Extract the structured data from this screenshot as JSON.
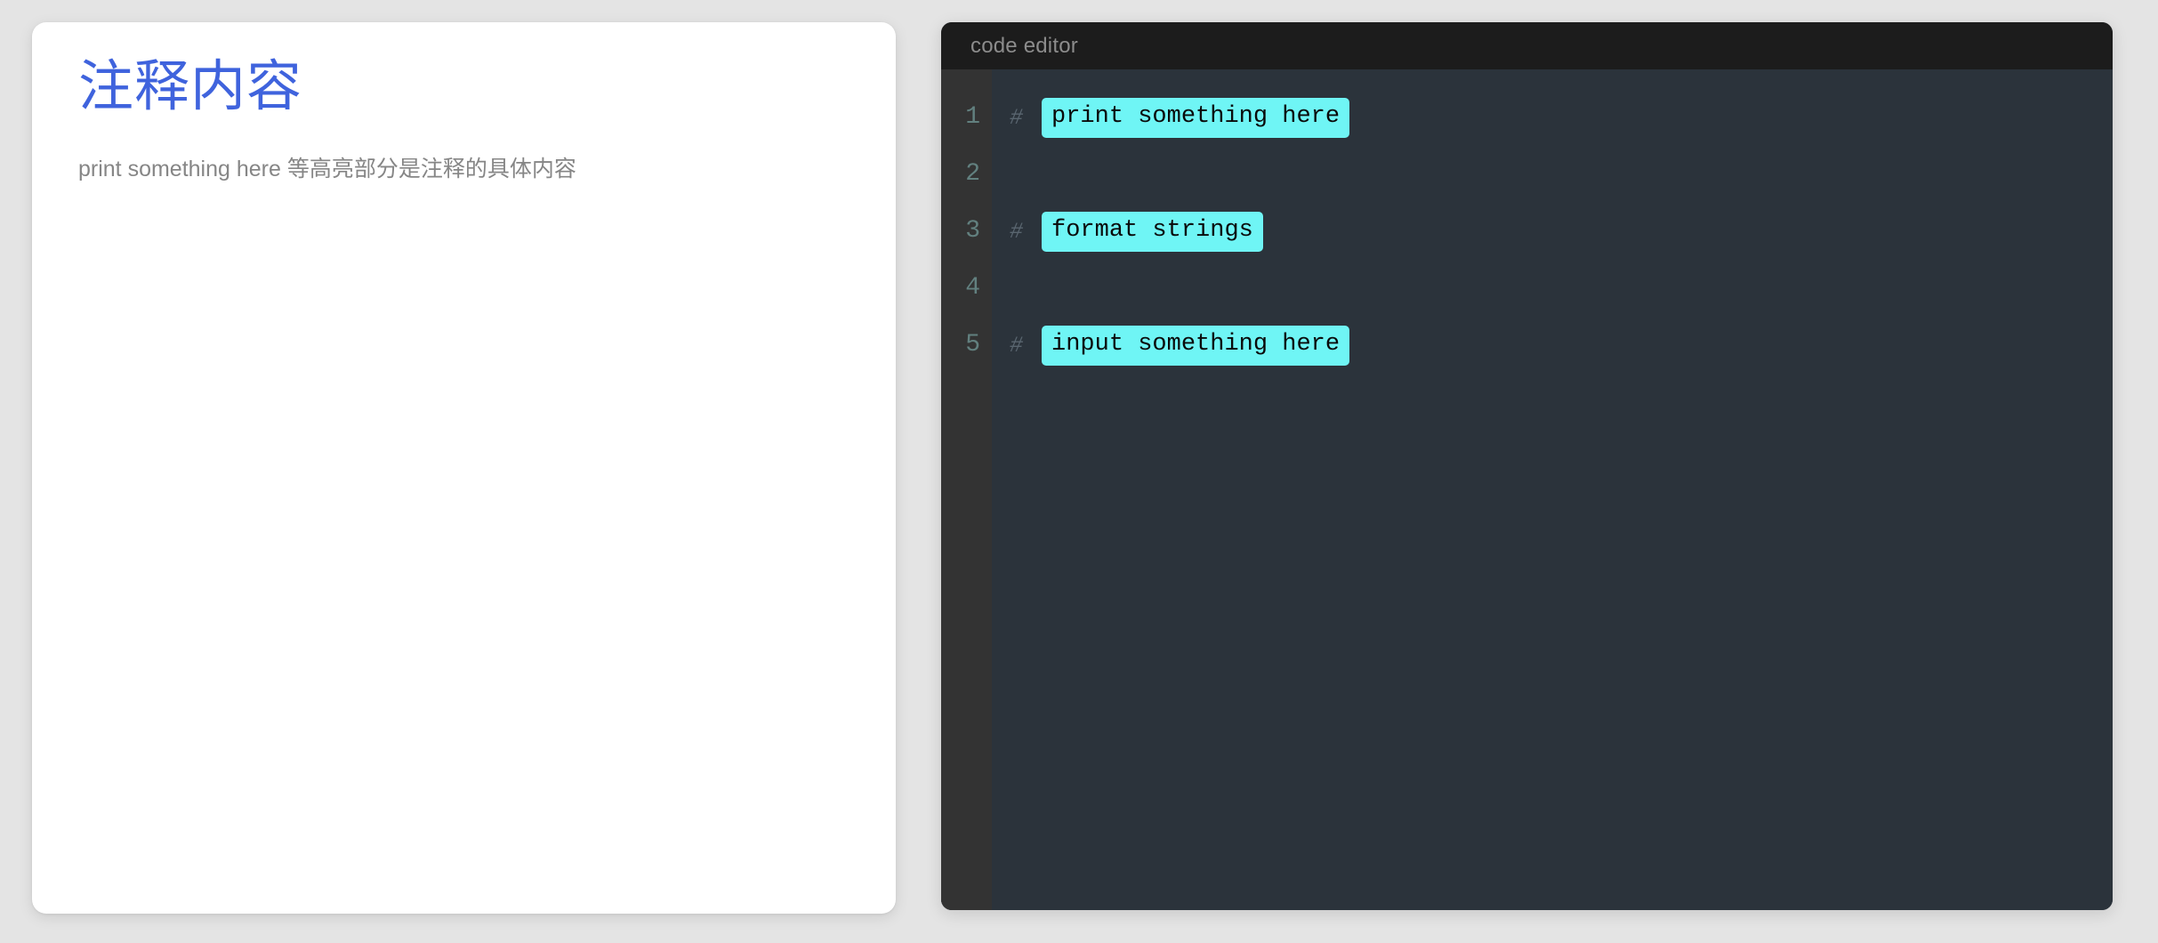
{
  "page": {
    "background_color": "#e4e4e4"
  },
  "info_card": {
    "title": "注释内容",
    "subtitle": "print something here 等高亮部分是注释的具体内容",
    "title_color": "#3f63dd",
    "subtitle_color": "#868686",
    "background_color": "#ffffff"
  },
  "editor": {
    "title": "code editor",
    "titlebar_color": "#1c1c1c",
    "body_color": "#2b333b",
    "gutter_color": "#333333",
    "line_number_color": "#62807f",
    "hash_color": "#59656f",
    "highlight_color": "#6ff5f5",
    "highlight_text_color": "#0a0a0a",
    "lines": [
      {
        "number": "1",
        "hash": "#",
        "comment": "print something here"
      },
      {
        "number": "2",
        "hash": "",
        "comment": ""
      },
      {
        "number": "3",
        "hash": "#",
        "comment": "format strings"
      },
      {
        "number": "4",
        "hash": "",
        "comment": ""
      },
      {
        "number": "5",
        "hash": "#",
        "comment": "input something here"
      }
    ]
  }
}
